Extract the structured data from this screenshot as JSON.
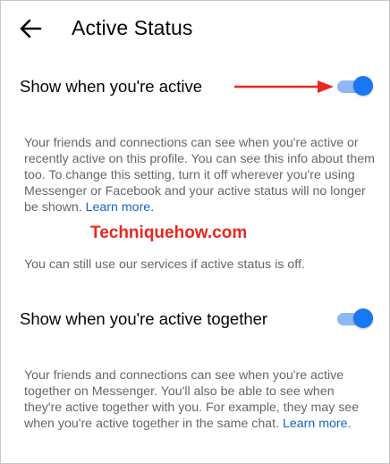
{
  "header": {
    "title": "Active Status",
    "back_icon": "arrow-left-icon"
  },
  "settings": [
    {
      "label": "Show when you're active",
      "enabled": true,
      "description": "Your friends and connections can see when you're active or recently active on this profile. You can see this info about them too. To change this setting, turn it off wherever you're using Messenger or Facebook and your active status will no longer be shown.",
      "link": "Learn more."
    },
    {
      "label": "Show when you're active together",
      "enabled": true,
      "description": "Your friends and connections can see when you're active together on Messenger. You'll also be able to see when they're active together with you. For example, they may see when you're active together in the same chat.",
      "link": "Learn more."
    }
  ],
  "note": "You can still use our services if active status is off.",
  "watermark": "Techniquehow.com",
  "colors": {
    "toggle_on": "#1877f2",
    "toggle_track": "#8fb8f2",
    "link": "#1664c8",
    "annotation_arrow": "#e8281e"
  }
}
